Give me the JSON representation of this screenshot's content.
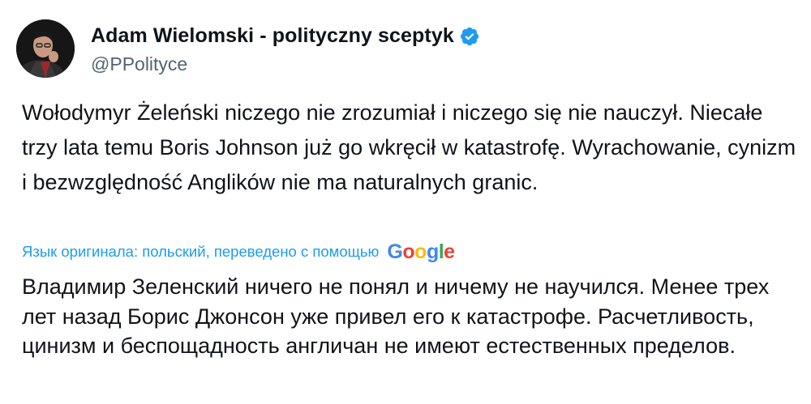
{
  "author": {
    "display_name": "Adam Wielomski - polityczny sceptyk",
    "handle": "@PPolityce",
    "verified": true,
    "avatar_icon": "profile-photo"
  },
  "tweet": {
    "text": "Wołodymyr Żeleński niczego nie zrozumiał i niczego się nie nauczył. Niecałe trzy lata temu Boris Johnson już go wkręcił w katastrofę. Wyrachowanie, cynizm i bezwzględność Anglików nie ma naturalnych granic."
  },
  "translation": {
    "note": "Язык оригинала: польский, переведено с помощью",
    "provider": "Google",
    "text": "Владимир Зеленский ничего не понял и ничему не научился. Менее трех лет назад Борис Джонсон уже привел его к катастрофе. Расчетливость, цинизм и беспощадность англичан не имеют естественных пределов."
  },
  "colors": {
    "link_blue": "#1d9bf0",
    "text_primary": "#0f1419",
    "text_secondary": "#536471",
    "google_blue": "#4285f4",
    "google_red": "#ea4335",
    "google_yellow": "#fbbc05",
    "google_green": "#34a853"
  }
}
